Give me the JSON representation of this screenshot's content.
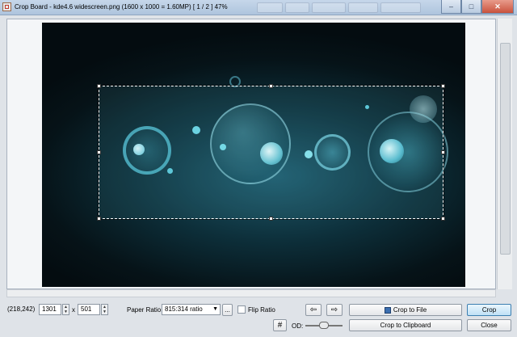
{
  "titlebar": {
    "app_name": "Crop Board",
    "separator": "-",
    "file_name": "kde4.6 widescreen.png",
    "image_info": "(1600 x 1000 = 1.60MP)",
    "page_info": "[ 1 / 2 ]",
    "zoom": "47%",
    "minimize_glyph": "–",
    "maximize_glyph": "□",
    "close_glyph": "✕"
  },
  "status": {
    "coordinates": "(218,242)"
  },
  "crop": {
    "width": "1301",
    "times": "x",
    "height": "501"
  },
  "paper_ratio": {
    "label": "Paper Ratio:",
    "value": "815:314 ratio",
    "more_button": "..."
  },
  "flip_ratio": {
    "label": "Flip Ratio",
    "checked": false
  },
  "buttons": {
    "prev_icon": "⇦",
    "next_icon": "⇨",
    "crop_to_file": "Crop to File",
    "crop_to_clipboard": "Crop to Clipboard",
    "crop": "Crop",
    "close": "Close",
    "grid_glyph": "#"
  },
  "od": {
    "label": "OD:"
  },
  "colors": {
    "accent": "#3c7fb1",
    "image_highlight": "#4fd0e0"
  }
}
